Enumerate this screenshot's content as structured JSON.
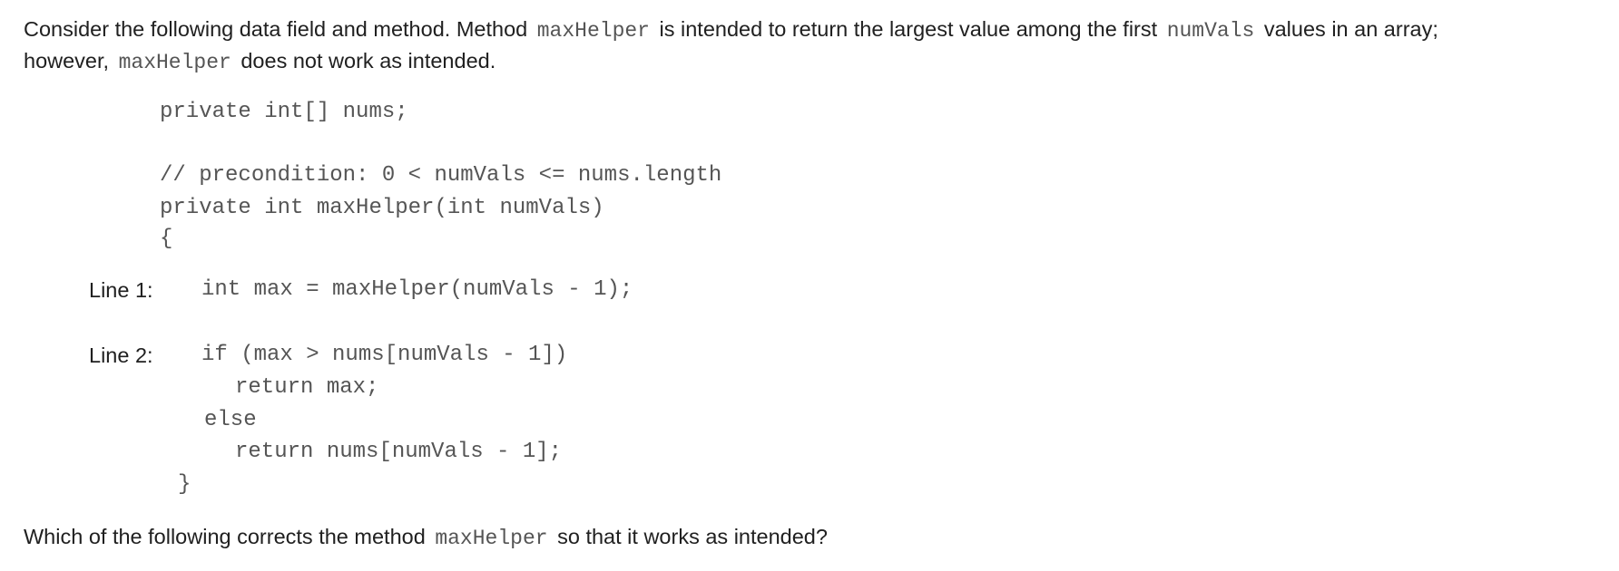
{
  "intro": {
    "part1": "Consider the following data field and method. Method",
    "code1": "maxHelper",
    "part2": "is intended to return the largest value among the first",
    "code2": "numVals",
    "part3": "values in an array;",
    "part4": "however,",
    "code3": "maxHelper",
    "part5": "does not work as intended."
  },
  "code": {
    "field_decl": "private int[] nums;",
    "comment": "// precondition: 0 < numVals <= nums.length",
    "signature": "private int maxHelper(int numVals)",
    "open_brace": "{",
    "line1_label": "Line 1:",
    "line1_code": "int max = maxHelper(numVals - 1);",
    "line2_label": "Line 2:",
    "line2_code": "if (max > nums[numVals - 1])",
    "return_max": "return max;",
    "else_kw": "else",
    "return_nums": "return nums[numVals - 1];",
    "close_brace": "}"
  },
  "question": {
    "part1": "Which of the following corrects the method",
    "code": "maxHelper",
    "part2": "so that it works as intended?"
  }
}
